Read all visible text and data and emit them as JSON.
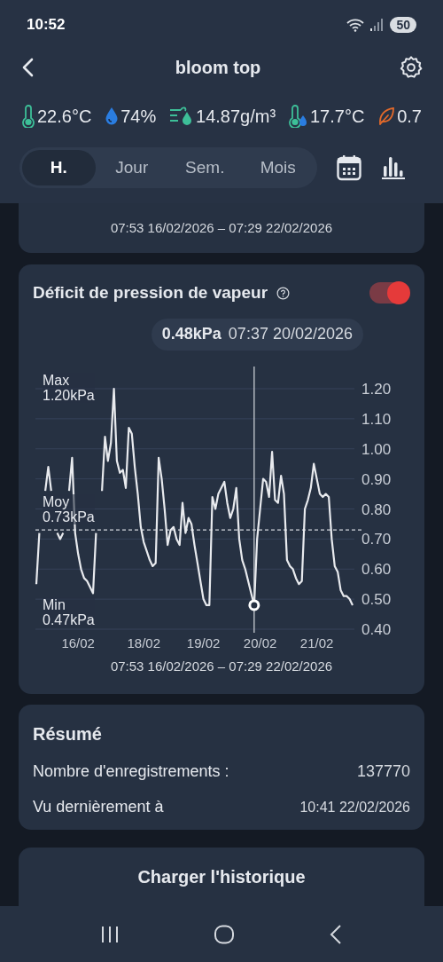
{
  "status_bar": {
    "time": "10:52",
    "battery": "50"
  },
  "header": {
    "title": "bloom top"
  },
  "readings": [
    {
      "kind": "temperature",
      "value": "22.6°C"
    },
    {
      "kind": "humidity",
      "value": "74%"
    },
    {
      "kind": "absolute_humidity",
      "value": "14.87g/m³"
    },
    {
      "kind": "dew_point",
      "value": "17.7°C"
    },
    {
      "kind": "vpd",
      "value": "0.7"
    }
  ],
  "tabs": [
    {
      "label": "H.",
      "selected": true
    },
    {
      "label": "Jour",
      "selected": false
    },
    {
      "label": "Sem.",
      "selected": false
    },
    {
      "label": "Mois",
      "selected": false
    }
  ],
  "previous_card": {
    "range": "07:53 16/02/2026 – 07:29 22/02/2026"
  },
  "vpd_card": {
    "title": "Déficit de pression de vapeur",
    "enabled": true,
    "tooltip": {
      "value": "0.48kPa",
      "time": "07:37 20/02/2026"
    },
    "stats": [
      {
        "kind": "max",
        "label": "Max",
        "value": "1.20kPa"
      },
      {
        "kind": "avg",
        "label": "Moy",
        "value": "0.73kPa"
      },
      {
        "kind": "min",
        "label": "Min",
        "value": "0.47kPa"
      }
    ],
    "chart_data": {
      "type": "line",
      "ylim": [
        0.4,
        1.2
      ],
      "yticks": [
        {
          "value": 1.2,
          "label": "1.20"
        },
        {
          "value": 1.1,
          "label": "1.10"
        },
        {
          "value": 1.0,
          "label": "1.00"
        },
        {
          "value": 0.9,
          "label": "0.90"
        },
        {
          "value": 0.8,
          "label": "0.80"
        },
        {
          "value": 0.7,
          "label": "0.70"
        },
        {
          "value": 0.6,
          "label": "0.60"
        },
        {
          "value": 0.5,
          "label": "0.50"
        },
        {
          "value": 0.4,
          "label": "0.40"
        }
      ],
      "categories": [
        null,
        null,
        null,
        null,
        null,
        null,
        null,
        null,
        null,
        null,
        null,
        null,
        null,
        null,
        "16/02",
        null,
        null,
        null,
        null,
        null,
        null,
        null,
        null,
        null,
        null,
        null,
        null,
        null,
        null,
        null,
        null,
        null,
        null,
        null,
        null,
        null,
        "18/02",
        null,
        null,
        null,
        null,
        null,
        null,
        null,
        null,
        null,
        null,
        null,
        null,
        null,
        null,
        null,
        null,
        null,
        null,
        null,
        "19/02",
        null,
        null,
        null,
        null,
        null,
        null,
        null,
        null,
        null,
        null,
        null,
        null,
        null,
        null,
        null,
        null,
        null,
        null,
        "20/02",
        null,
        null,
        null,
        null,
        null,
        null,
        null,
        null,
        null,
        null,
        null,
        null,
        null,
        null,
        null,
        null,
        null,
        null,
        "21/02",
        null,
        null,
        null,
        null,
        null,
        null,
        null,
        null,
        null,
        null,
        null,
        null
      ],
      "series": [
        {
          "color": "#e8eaee",
          "values": [
            0.55,
            0.72,
            null,
            0.86,
            0.94,
            0.86,
            null,
            0.72,
            0.7,
            0.72,
            null,
            0.86,
            0.97,
            0.72,
            0.65,
            0.6,
            0.57,
            0.56,
            0.54,
            0.52,
            0.72,
            null,
            0.86,
            1.04,
            0.96,
            1.02,
            1.2,
            0.96,
            0.92,
            0.93,
            0.87,
            1.07,
            1.05,
            0.94,
            0.85,
            0.74,
            0.69,
            0.66,
            0.63,
            0.61,
            0.62,
            0.97,
            0.9,
            0.8,
            0.68,
            0.73,
            0.74,
            0.7,
            0.68,
            0.82,
            0.72,
            0.77,
            0.75,
            0.68,
            0.62,
            0.56,
            0.5,
            0.48,
            0.48,
            0.84,
            0.8,
            0.85,
            0.87,
            0.89,
            0.82,
            0.77,
            0.8,
            0.87,
            0.7,
            0.63,
            0.6,
            0.56,
            0.52,
            0.48,
            0.7,
            0.8,
            0.9,
            0.89,
            0.84,
            0.99,
            0.83,
            0.82,
            0.91,
            0.85,
            0.63,
            0.61,
            0.6,
            0.57,
            0.55,
            0.56,
            0.8,
            0.83,
            0.87,
            0.95,
            0.9,
            0.85,
            0.84,
            0.85,
            0.84,
            0.7,
            0.61,
            0.59,
            0.53,
            0.51,
            0.51,
            0.5,
            0.48
          ]
        },
        {
          "color": "#ffffff",
          "marker": "circle",
          "values": [
            null,
            null,
            null,
            null,
            null,
            null,
            null,
            null,
            null,
            null,
            null,
            null,
            null,
            null,
            null,
            null,
            null,
            null,
            null,
            null,
            null,
            null,
            null,
            null,
            null,
            null,
            null,
            null,
            null,
            null,
            null,
            null,
            null,
            null,
            null,
            null,
            null,
            null,
            null,
            null,
            null,
            null,
            null,
            null,
            null,
            null,
            null,
            null,
            null,
            null,
            null,
            null,
            null,
            null,
            null,
            null,
            null,
            null,
            null,
            null,
            null,
            null,
            null,
            null,
            null,
            null,
            null,
            null,
            null,
            null,
            null,
            null,
            null,
            0.48,
            null,
            null,
            null,
            null,
            null,
            null,
            null,
            null,
            null,
            null,
            null,
            null,
            null,
            null,
            null,
            null,
            null,
            null,
            null,
            null,
            null,
            null,
            null,
            null,
            null,
            null,
            null,
            null,
            null,
            null,
            null,
            null,
            null
          ]
        }
      ],
      "grid": true,
      "ref_lines": [
        {
          "axis": "y",
          "value": 0.73
        }
      ]
    },
    "range": "07:53 16/02/2026 – 07:29 22/02/2026"
  },
  "summary": {
    "title": "Résumé",
    "rows": [
      {
        "label": "Nombre d'enregistrements :",
        "value": "137770"
      },
      {
        "label": "Vu dernièrement à",
        "value": "10:41 22/02/2026"
      }
    ]
  },
  "load_button": "Charger l'historique"
}
